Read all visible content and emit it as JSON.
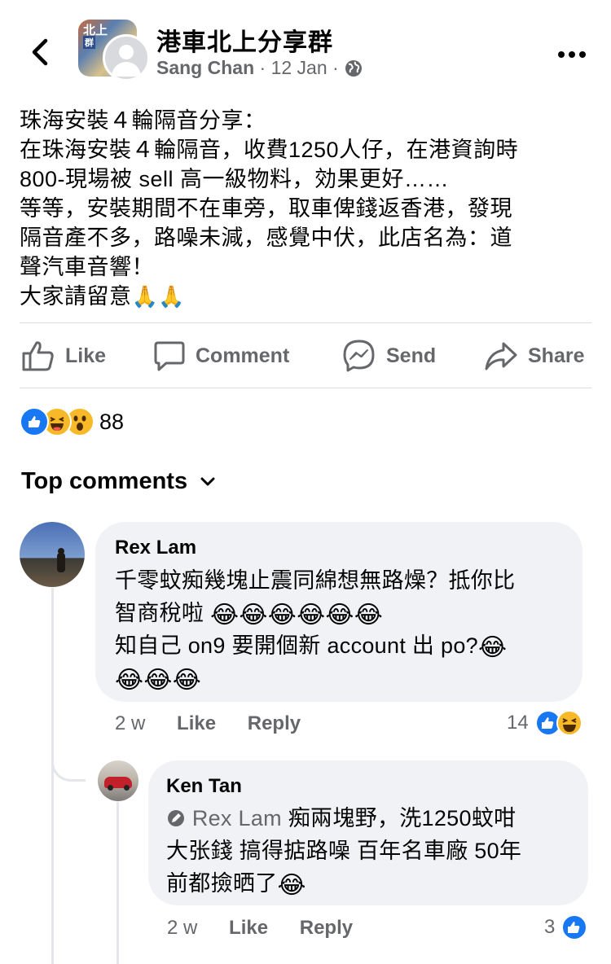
{
  "header": {
    "group_name": "港車北上分享群",
    "group_avatar_text": [
      "北上",
      "群"
    ],
    "author": "Sang Chan",
    "time": "· 12 Jan ·"
  },
  "post": {
    "lines": [
      "珠海安裝４輪隔音分享：",
      " 在珠海安裝４輪隔音，收費1250人仔，在港資詢時",
      "800-現場被 sell 高一級物料，効果更好……",
      "等等，安裝期間不在車旁，取車俾錢返香港，發現",
      "隔音產不多，路噪未減，感覺中伏，此店名為：道",
      "聲汽車音響！",
      "大家請留意"
    ],
    "trailing_emoji": "🙏🙏"
  },
  "actions": {
    "like": "Like",
    "comment": "Comment",
    "send": "Send",
    "share": "Share"
  },
  "reactions": {
    "icons": [
      "like-icon",
      "haha-icon",
      "wow-icon"
    ],
    "count": "88"
  },
  "top_comments_label": "Top comments",
  "comments": [
    {
      "name": "Rex Lam",
      "line1": "千零蚊痴幾塊止震同綿想無路燥？抵你比",
      "line2": "智商稅啦",
      "line2_emoji": "😂😂😂😂😂😂",
      "line3": "知自己 on9 要開個新 account 出 po?",
      "line3_emoji": "😂",
      "line4_emoji": "😂😂😂",
      "time": "2 w",
      "like": "Like",
      "reply": "Reply",
      "reaction_count": "14"
    },
    {
      "name": "Ken Tan",
      "mention": "Rex Lam",
      "line1": " 痴兩塊野，洗1250蚊咁",
      "line2": "大张錢 搞得掂路噪 百年名車廠 50年",
      "line3": "前都撿晒了",
      "line3_emoji": "😂",
      "time": "2 w",
      "like": "Like",
      "reply": "Reply",
      "reaction_count": "3"
    }
  ],
  "colors": {
    "facebook_blue": "#1877f2",
    "secondary_text": "#65676b",
    "bubble": "#f0f2f5",
    "divider": "#dadde1"
  }
}
